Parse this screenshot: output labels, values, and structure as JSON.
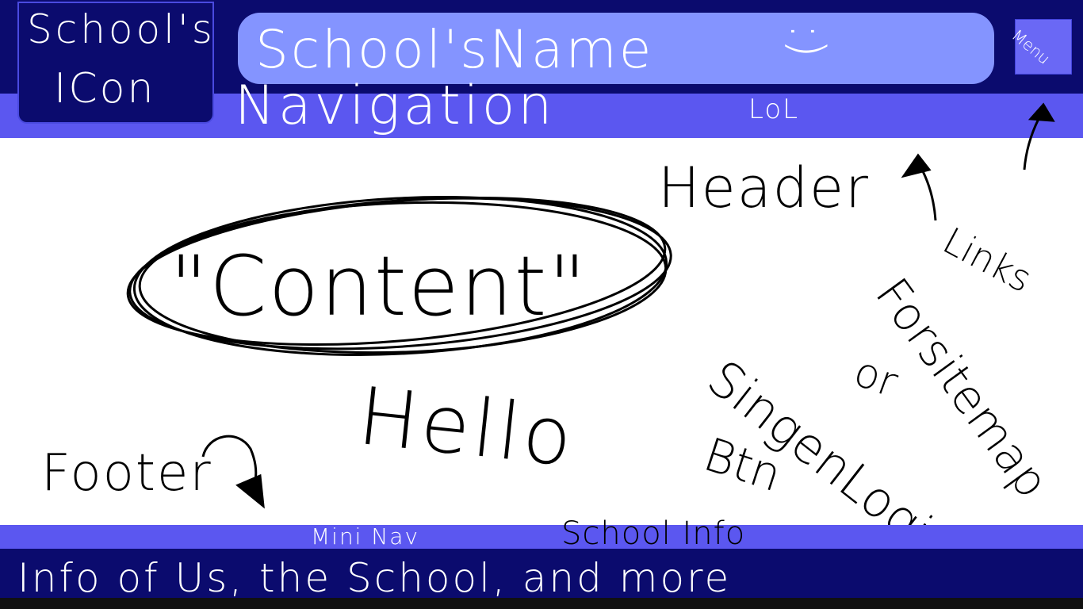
{
  "header": {
    "icon_line1": "School's",
    "icon_line2": "ICon",
    "school_name": "School'sName",
    "smiley": ":)",
    "menu_label": "Menu",
    "navigation": "Navigation",
    "lol": "LoL"
  },
  "main": {
    "content": "\"Content\"",
    "hello": "Hello"
  },
  "annotations": {
    "header": "Header",
    "links": "Links",
    "for_sitemap": "Forsitemap",
    "or": "or",
    "sign_login": "SingenLogin",
    "btn": "Btn",
    "footer": "Footer"
  },
  "footer": {
    "mini_nav": "Mini Nav",
    "school_info": "School Info",
    "info_text": "Info of Us, the School, and more"
  },
  "colors": {
    "dark_navy": "#0b0b6e",
    "nav_blue": "#5b57f0",
    "pill_blue": "#8494ff"
  }
}
